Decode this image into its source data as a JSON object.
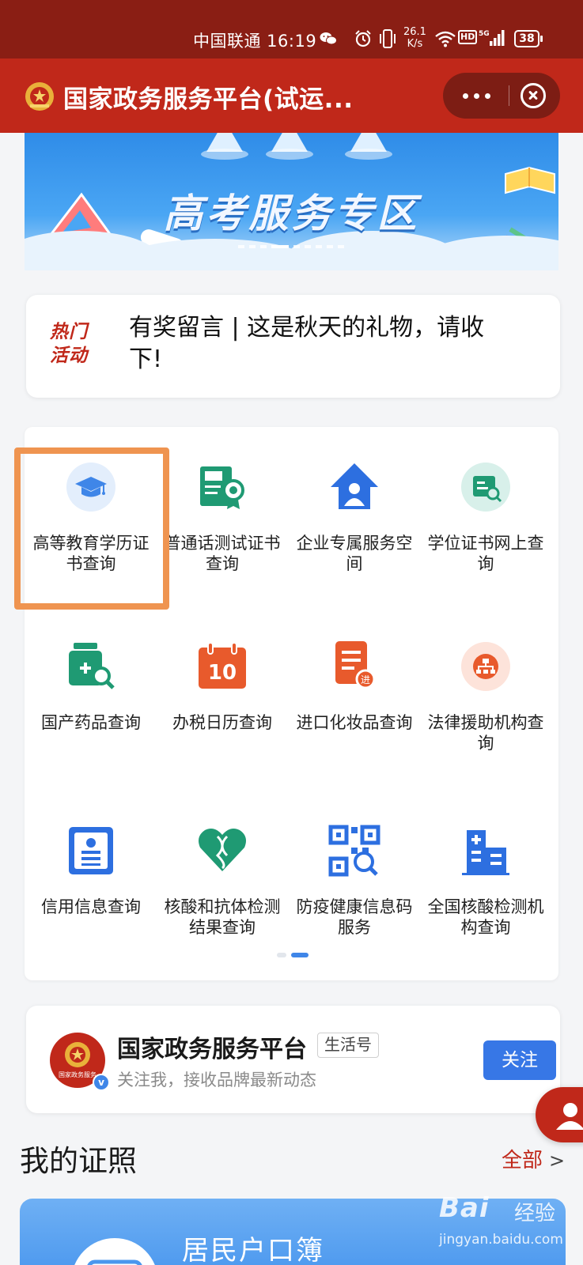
{
  "status_bar": {
    "carrier_time": "中国联通 16:19",
    "net_speed_value": "26.1",
    "net_speed_unit": "K/s",
    "hd_label": "HD",
    "network_label": "5G",
    "battery": "38"
  },
  "header": {
    "title": "国家政务服务平台(试运..."
  },
  "banner": {
    "text": "高考服务专区"
  },
  "hot_activity": {
    "tag_line1": "热门",
    "tag_line2": "活动",
    "text": "有奖留言 | 这是秋天的礼物，请收下!"
  },
  "services": [
    {
      "label": "高等教育学历证书查询",
      "icon": "graduation-cap-icon"
    },
    {
      "label": "普通话测试证书查询",
      "icon": "certificate-icon"
    },
    {
      "label": "企业专属服务空间",
      "icon": "enterprise-house-icon"
    },
    {
      "label": "学位证书网上查询",
      "icon": "degree-search-icon"
    },
    {
      "label": "国产药品查询",
      "icon": "medicine-search-icon"
    },
    {
      "label": "办税日历查询",
      "icon": "tax-calendar-icon"
    },
    {
      "label": "进口化妆品查询",
      "icon": "import-cosmetics-icon"
    },
    {
      "label": "法律援助机构查询",
      "icon": "legal-aid-icon"
    },
    {
      "label": "信用信息查询",
      "icon": "credit-info-icon"
    },
    {
      "label": "核酸和抗体检测结果查询",
      "icon": "dna-heart-icon"
    },
    {
      "label": "防疫健康信息码服务",
      "icon": "qr-code-icon"
    },
    {
      "label": "全国核酸检测机构查询",
      "icon": "hospital-icon"
    }
  ],
  "follow_card": {
    "name": "国家政务服务平台",
    "badge": "生活号",
    "description": "关注我，接收品牌最新动态",
    "avatar_text": "国家政务服务",
    "button": "关注"
  },
  "my_licenses": {
    "title": "我的证照",
    "all_link": "全部",
    "first_card_title": "居民户口簿"
  },
  "watermark": {
    "brand": "Bai",
    "brand_cn": "经验",
    "site": "jingyan.baidu.com"
  },
  "colors": {
    "status_bar": "#8a1e14",
    "header": "#c0281a",
    "accent_blue": "#3777e6",
    "highlight_orange": "#ef9450"
  }
}
